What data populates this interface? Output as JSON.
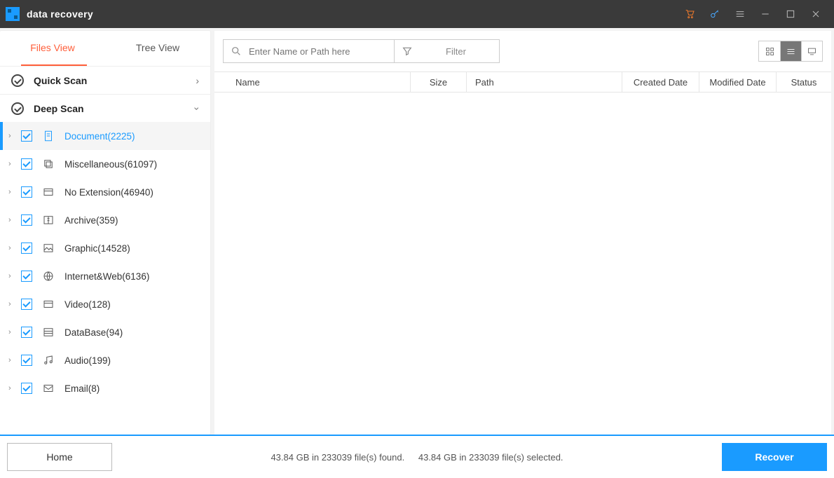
{
  "titlebar": {
    "title": "data recovery"
  },
  "sidebar": {
    "tabs": {
      "files": "Files View",
      "tree": "Tree View"
    },
    "sections": {
      "quick": "Quick Scan",
      "deep": "Deep Scan"
    },
    "nodes": [
      {
        "label": "Document(2225)"
      },
      {
        "label": "Miscellaneous(61097)"
      },
      {
        "label": "No Extension(46940)"
      },
      {
        "label": "Archive(359)"
      },
      {
        "label": "Graphic(14528)"
      },
      {
        "label": "Internet&Web(6136)"
      },
      {
        "label": "Video(128)"
      },
      {
        "label": "DataBase(94)"
      },
      {
        "label": "Audio(199)"
      },
      {
        "label": "Email(8)"
      }
    ]
  },
  "toolbar": {
    "search_placeholder": "Enter Name or Path here",
    "filter_label": "Filter"
  },
  "columns": {
    "name": "Name",
    "size": "Size",
    "path": "Path",
    "created": "Created Date",
    "modified": "Modified Date",
    "status": "Status"
  },
  "footer": {
    "home": "Home",
    "found": "43.84 GB in 233039 file(s) found.",
    "selected": "43.84 GB in 233039 file(s) selected.",
    "recover": "Recover"
  }
}
